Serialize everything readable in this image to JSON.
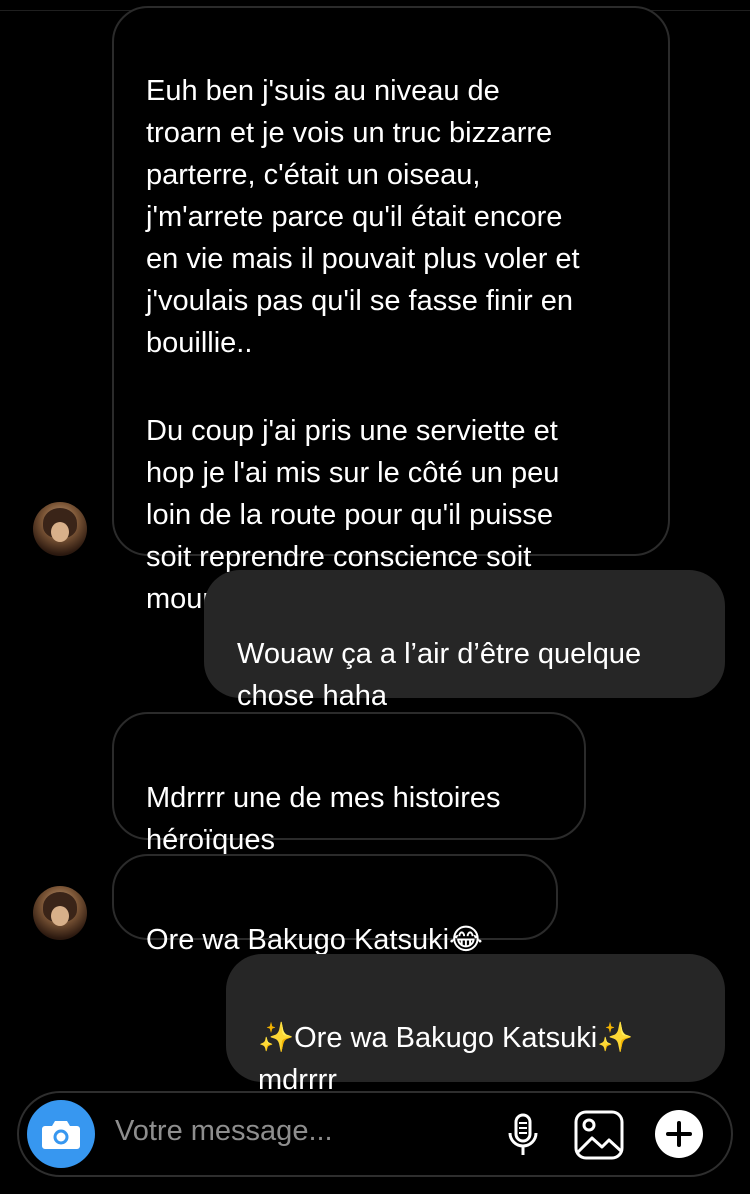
{
  "messages": [
    {
      "direction": "incoming",
      "paragraphs": [
        "Euh ben j'suis au niveau de\ntroarn et je vois un truc bizzarre\nparterre, c'était un oiseau,\nj'm'arrete parce qu'il était encore\nen vie mais il pouvait plus voler et\nj'voulais pas qu'il se fasse finir en\nbouillie..",
        "Du coup j'ai pris une serviette et\nhop je l'ai mis sur le côté un peu\nloin de la route pour qu'il puisse\nsoit reprendre conscience soit\nmourir, au choix"
      ]
    },
    {
      "direction": "outgoing",
      "text": "Wouaw ça a l’air d’être quelque\nchose haha"
    },
    {
      "direction": "incoming",
      "text": "Mdrrrr une de mes histoires\nhéroïques"
    },
    {
      "direction": "incoming",
      "text": "Ore wa Bakugo Katsuki😂"
    },
    {
      "direction": "outgoing",
      "text": "✨Ore wa Bakugo Katsuki✨\nmdrrrr"
    }
  ],
  "composer": {
    "placeholder": "Votre message...",
    "icons": [
      "camera-icon",
      "microphone-icon",
      "gallery-icon",
      "plus-icon"
    ],
    "accent": "#3797f0"
  },
  "colors": {
    "background": "#000000",
    "outgoing_bubble": "#262626",
    "incoming_border": "#2b2b2b",
    "placeholder": "#8e8e8e"
  }
}
